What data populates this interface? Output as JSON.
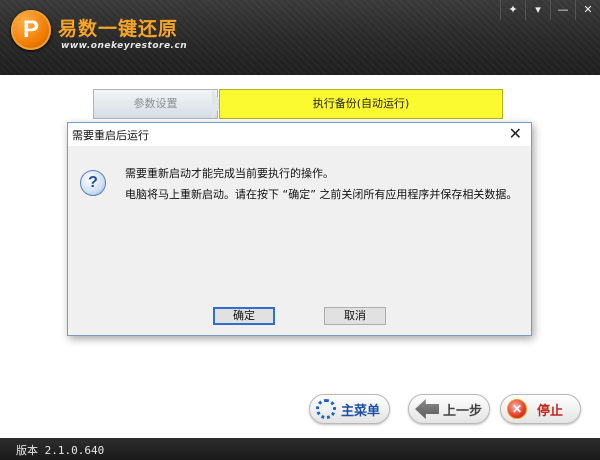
{
  "app": {
    "title": "易数一键还原",
    "url": "www.onekeyrestore.cn",
    "logo_letter": "P",
    "controls": {
      "pin": "✦",
      "menu": "▾",
      "minimize": "—",
      "close": "✕"
    }
  },
  "steps": [
    {
      "label": "参数设置",
      "state": "completed"
    },
    {
      "label": "执行备份(自动运行)",
      "state": "active"
    }
  ],
  "dialog": {
    "title": "需要重启后运行",
    "close": "✕",
    "icon": "question-icon",
    "icon_glyph": "?",
    "message_line1": "需要重新启动才能完成当前要执行的操作。",
    "message_line2": "电脑将马上重新启动。请在按下 “确定” 之前关闭所有应用程序并保存相关数据。",
    "ok_label": "确定",
    "cancel_label": "取消"
  },
  "bottom_buttons": {
    "menu_label": "主菜单",
    "prev_label": "上一步",
    "stop_label": "停止",
    "stop_glyph": "✕"
  },
  "status": {
    "version": "版本 2.1.0.640"
  },
  "colors": {
    "accent_orange": "#f7a427",
    "active_step": "#fbf930",
    "header_bg": "#2b2b2b",
    "dialog_border": "#7a9bc4",
    "ok_focus": "#2f6fd1"
  }
}
